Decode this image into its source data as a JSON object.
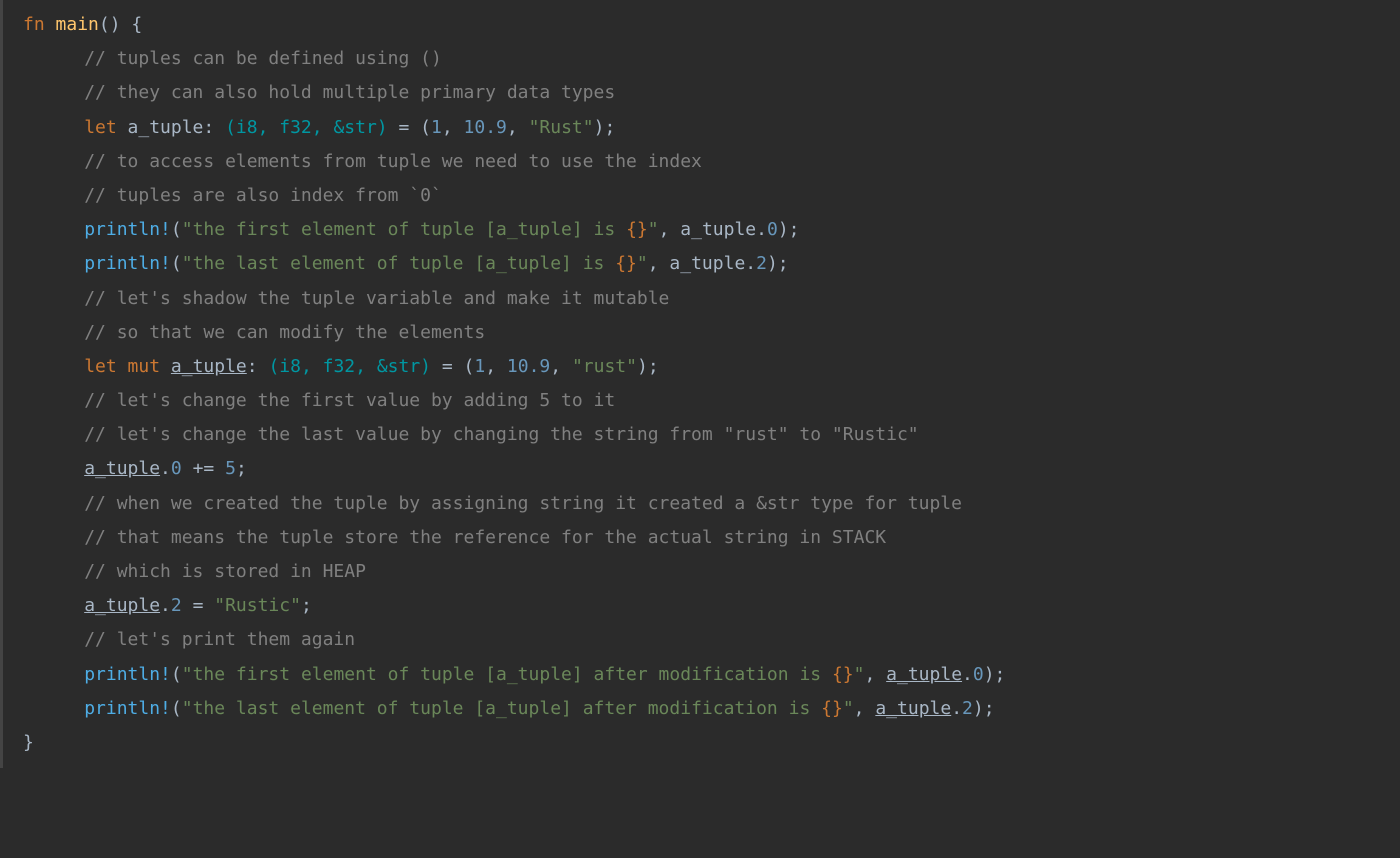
{
  "code": {
    "l1_fn": "fn",
    "l1_main": "main",
    "l1_rest": "() {",
    "l2_cmt": "// tuples can be defined using ()",
    "l3_cmt": "// they can also hold multiple primary data types",
    "l4_let": "let",
    "l4_var": " a_tuple: ",
    "l4_type": "(i8, f32, &str)",
    "l4_eq": " = (",
    "l4_n1": "1",
    "l4_c1": ", ",
    "l4_n2": "10.9",
    "l4_c2": ", ",
    "l4_s1": "\"Rust\"",
    "l4_end": ");",
    "l5_cmt": "// to access elements from tuple we need to use the index",
    "l6_cmt": "// tuples are also index from `0`",
    "l7_mac": "println!",
    "l7_p1": "(",
    "l7_s1a": "\"the first element of tuple [a_tuple] is ",
    "l7_pl": "{}",
    "l7_s1b": "\"",
    "l7_c1": ", a_tuple.",
    "l7_n1": "0",
    "l7_end": ");",
    "l8_mac": "println!",
    "l8_p1": "(",
    "l8_s1a": "\"the last element of tuple [a_tuple] is ",
    "l8_pl": "{}",
    "l8_s1b": "\"",
    "l8_c1": ", a_tuple.",
    "l8_n1": "2",
    "l8_end": ");",
    "l9_cmt": "// let's shadow the tuple variable and make it mutable",
    "l10_cmt": "// so that we can modify the elements",
    "l11_let": "let",
    "l11_mut": " mut",
    "l11_var": "a_tuple",
    "l11_col": ": ",
    "l11_type": "(i8, f32, &str)",
    "l11_eq": " = (",
    "l11_n1": "1",
    "l11_c1": ", ",
    "l11_n2": "10.9",
    "l11_c2": ", ",
    "l11_s1": "\"rust\"",
    "l11_end": ");",
    "l12_cmt": "// let's change the first value by adding 5 to it",
    "l13_cmt": "// let's change the last value by changing the string from \"rust\" to \"Rustic\"",
    "l14_var": "a_tuple",
    "l14_dot": ".",
    "l14_n1": "0",
    "l14_op": " += ",
    "l14_n2": "5",
    "l14_end": ";",
    "l15_cmt": "// when we created the tuple by assigning string it created a &str type for tuple",
    "l16_cmt": "// that means the tuple store the reference for the actual string in STACK",
    "l17_cmt": "// which is stored in HEAP",
    "l18_var": "a_tuple",
    "l18_dot": ".",
    "l18_n1": "2",
    "l18_eq": " = ",
    "l18_s1": "\"Rustic\"",
    "l18_end": ";",
    "l19_cmt": "// let's print them again",
    "l20_mac": "println!",
    "l20_p1": "(",
    "l20_s1a": "\"the first element of tuple [a_tuple] after modification is ",
    "l20_pl": "{}",
    "l20_s1b": "\"",
    "l20_c1": ", ",
    "l20_var": "a_tuple",
    "l20_dot": ".",
    "l20_n1": "0",
    "l20_end": ");",
    "l21_mac": "println!",
    "l21_p1": "(",
    "l21_s1a": "\"the last element of tuple [a_tuple] after modification is ",
    "l21_pl": "{}",
    "l21_s1b": "\"",
    "l21_c1": ", ",
    "l21_var": "a_tuple",
    "l21_dot": ".",
    "l21_n1": "2",
    "l21_end": ");",
    "l22_brace": "}"
  }
}
